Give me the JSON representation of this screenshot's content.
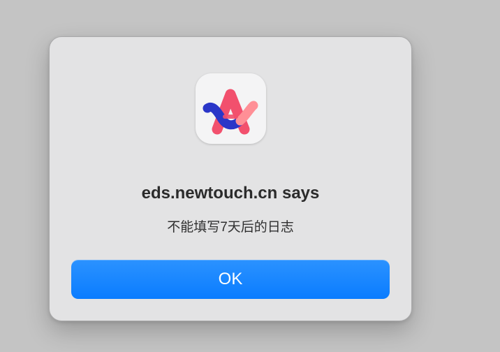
{
  "alert": {
    "app_icon": "arc-browser-icon",
    "title": "eds.newtouch.cn says",
    "message": "不能填写7天后的日志",
    "ok_label": "OK"
  },
  "colors": {
    "button_accent": "#0a7cff",
    "dialog_background": "#e3e3e4",
    "backdrop": "#c4c4c4"
  }
}
